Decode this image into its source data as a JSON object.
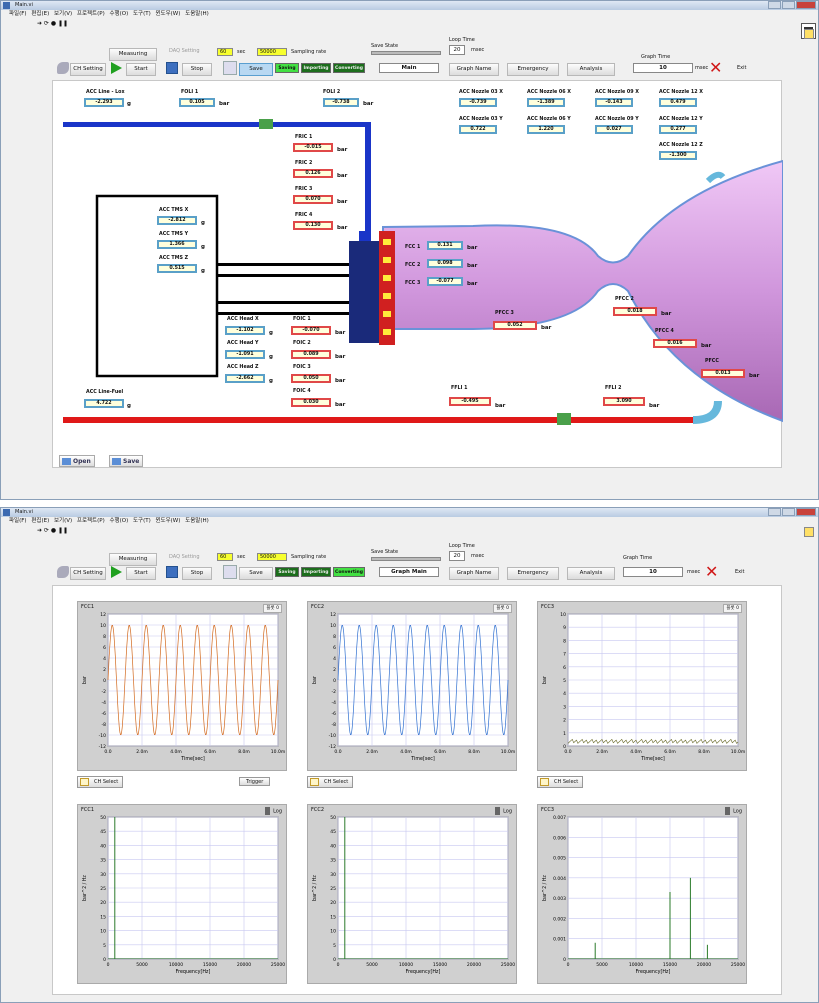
{
  "window": {
    "title": "Main.vi",
    "menu": "파일(F) 편집(E) 보기(V) 프로젝트(P) 수행(O) 도구(T) 윈도우(W) 도움말(H)"
  },
  "toolbar": {
    "ch_setting": "CH Setting",
    "start": "Start",
    "stop": "Stop",
    "save_top": "Save",
    "save_bottom": "Save",
    "measuring": "Measuring",
    "daq_setting": "DAQ Setting",
    "sec_value": "60",
    "sec_label": "sec",
    "sampling_value": "50000",
    "sampling_label": "Sampling rate",
    "saving": "Saving",
    "importing": "Importing",
    "converting": "Converting",
    "save_state": "Save State",
    "loop_time": "Loop Time",
    "loop_value": "20",
    "loop_unit": "msec",
    "graph_name_top": "Main",
    "graph_name_bottom": "Graph Main",
    "graph_name_btn": "Graph Name",
    "emergency": "Emergency",
    "analysis": "Analysis",
    "graph_time": "Graph Time",
    "graph_time_value": "10",
    "graph_time_unit": "msec",
    "exit": "Exit"
  },
  "main": {
    "acc_line_lox": {
      "label": "ACC Line - Lox",
      "value": "-2.293",
      "unit": "g"
    },
    "foli1": {
      "label": "FOLI 1",
      "value": "0.105",
      "unit": "bar"
    },
    "foli2": {
      "label": "FOLI 2",
      "value": "-0.738",
      "unit": "bar"
    },
    "acc_nozzle": [
      {
        "label": "ACC Nozzle 03 X",
        "value": "-0.739"
      },
      {
        "label": "ACC Nozzle 06 X",
        "value": "-1.389"
      },
      {
        "label": "ACC Nozzle 09 X",
        "value": "-0.143"
      },
      {
        "label": "ACC Nozzle 12 X",
        "value": "0.479"
      },
      {
        "label": "ACC Nozzle 03 Y",
        "value": "0.722"
      },
      {
        "label": "ACC Nozzle 06 Y",
        "value": "1.220"
      },
      {
        "label": "ACC Nozzle 09 Y",
        "value": "0.027"
      },
      {
        "label": "ACC Nozzle 12 Y",
        "value": "0.277"
      },
      {
        "label": "ACC Nozzle 12 Z",
        "value": "-1.300"
      }
    ],
    "fric": [
      {
        "label": "FRIC 1",
        "value": "-0.015"
      },
      {
        "label": "FRIC 2",
        "value": "0.126"
      },
      {
        "label": "FRIC 3",
        "value": "0.070"
      },
      {
        "label": "FRIC 4",
        "value": "0.130"
      }
    ],
    "acc_tms": [
      {
        "label": "ACC TMS X",
        "value": "-2.812"
      },
      {
        "label": "ACC TMS Y",
        "value": "1.366"
      },
      {
        "label": "ACC TMS Z",
        "value": "0.515"
      }
    ],
    "fcc": [
      {
        "label": "FCC 1",
        "value": "0.131"
      },
      {
        "label": "FCC 2",
        "value": "0.098"
      },
      {
        "label": "FCC 3",
        "value": "-0.077"
      }
    ],
    "acc_head": [
      {
        "label": "ACC Head X",
        "value": "-1.102"
      },
      {
        "label": "ACC Head Y",
        "value": "-1.091"
      },
      {
        "label": "ACC Head Z",
        "value": "-2.662"
      }
    ],
    "foic": [
      {
        "label": "FOIC 1",
        "value": "-0.070"
      },
      {
        "label": "FOIC 2",
        "value": "0.089"
      },
      {
        "label": "FOIC 3",
        "value": "0.050"
      },
      {
        "label": "FOIC 4",
        "value": "0.030"
      }
    ],
    "pfcc3": {
      "label": "PFCC 3",
      "value": "0.052"
    },
    "pfcc2": {
      "label": "PFCC 2",
      "value": "0.018"
    },
    "pfcc4": {
      "label": "PFCC 4",
      "value": "0.016"
    },
    "pfcc5": {
      "label": "PFCC",
      "value": "0.013"
    },
    "acc_line_fuel": {
      "label": "ACC Line-Fuel",
      "value": "4.722",
      "unit": "g"
    },
    "ffli1": {
      "label": "FFLI 1",
      "value": "-0.495",
      "unit": "bar"
    },
    "ffli2": {
      "label": "FFLI 2",
      "value": "3.090",
      "unit": "bar"
    },
    "bar_unit": "bar",
    "g_unit": "g",
    "open_button": "Open",
    "save_button": "Save"
  },
  "graphs": {
    "time": [
      {
        "title": "FCC1",
        "zoom": "플롯 0",
        "color": "#d2691e",
        "ylabel": "bar",
        "xlabel": "Time[sec]"
      },
      {
        "title": "FCC2",
        "zoom": "플롯 0",
        "color": "#3070d0",
        "ylabel": "bar",
        "xlabel": "Time[sec]"
      },
      {
        "title": "FCC3",
        "zoom": "플롯 0",
        "color": "#6a6a2a",
        "ylabel": "bar",
        "xlabel": "Time[sec]"
      }
    ],
    "freq": [
      {
        "title": "FCC1",
        "ylabel": "bar^2 / Hz",
        "xlabel": "Frequency[Hz]"
      },
      {
        "title": "FCC2",
        "ylabel": "bar^2 / Hz",
        "xlabel": "Frequency[Hz]"
      },
      {
        "title": "FCC3",
        "ylabel": "bar^2 / Hz",
        "xlabel": "Frequency[Hz]"
      }
    ],
    "time_yticks_a": [
      "12",
      "10",
      "8",
      "6",
      "4",
      "2",
      "0",
      "-2",
      "-4",
      "-6",
      "-8",
      "-10",
      "-12"
    ],
    "time_yticks_c": [
      "10",
      "9",
      "8",
      "7",
      "6",
      "5",
      "4",
      "3",
      "2",
      "1",
      "0"
    ],
    "time_xticks": [
      "0.0",
      "2.0m",
      "4.0m",
      "6.0m",
      "8.0m",
      "10.0m"
    ],
    "freq_yticks_ab": [
      "50",
      "45",
      "40",
      "35",
      "30",
      "25",
      "20",
      "15",
      "10",
      "5",
      "0"
    ],
    "freq_yticks_c": [
      "0.007",
      "0.006",
      "0.005",
      "0.004",
      "0.003",
      "0.002",
      "0.001",
      "0"
    ],
    "freq_xticks": [
      "0",
      "5000",
      "10000",
      "15000",
      "20000",
      "25000"
    ],
    "ch_select": "CH Select",
    "trigger": "Trigger",
    "log": "Log"
  },
  "chart_data": [
    {
      "type": "line",
      "title": "FCC1",
      "xlabel": "Time[sec]",
      "ylabel": "bar",
      "ylim": [
        -12,
        12
      ],
      "xlim": [
        0,
        0.01
      ],
      "cycles": 10,
      "amplitude": 10
    },
    {
      "type": "line",
      "title": "FCC2",
      "xlabel": "Time[sec]",
      "ylabel": "bar",
      "ylim": [
        -12,
        12
      ],
      "xlim": [
        0,
        0.01
      ],
      "cycles": 10,
      "amplitude": 10
    },
    {
      "type": "line",
      "title": "FCC3",
      "xlabel": "Time[sec]",
      "ylabel": "bar",
      "ylim": [
        0,
        10
      ],
      "xlim": [
        0,
        0.01
      ],
      "level": 0.2
    },
    {
      "type": "line",
      "title": "FCC1",
      "xlabel": "Frequency[Hz]",
      "ylabel": "bar^2 / Hz",
      "ylim": [
        0,
        50
      ],
      "xlim": [
        0,
        25000
      ],
      "peaks": [
        {
          "x": 1000,
          "y": 50
        }
      ]
    },
    {
      "type": "line",
      "title": "FCC2",
      "xlabel": "Frequency[Hz]",
      "ylabel": "bar^2 / Hz",
      "ylim": [
        0,
        50
      ],
      "xlim": [
        0,
        25000
      ],
      "peaks": [
        {
          "x": 1000,
          "y": 50
        }
      ]
    },
    {
      "type": "line",
      "title": "FCC3",
      "xlabel": "Frequency[Hz]",
      "ylabel": "bar^2 / Hz",
      "ylim": [
        0,
        0.007
      ],
      "xlim": [
        0,
        25000
      ],
      "peaks": [
        {
          "x": 4000,
          "y": 0.0008
        },
        {
          "x": 15000,
          "y": 0.0033
        },
        {
          "x": 18000,
          "y": 0.004
        },
        {
          "x": 20500,
          "y": 0.0007
        }
      ]
    }
  ]
}
